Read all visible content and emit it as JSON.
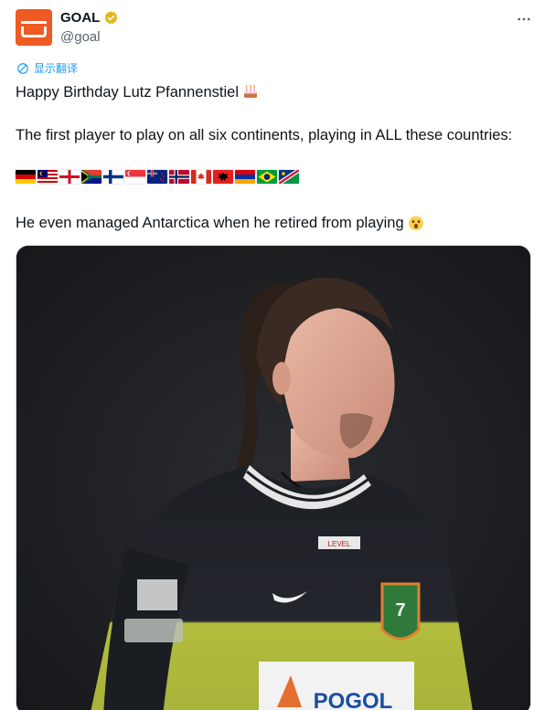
{
  "account": {
    "display_name": "GOAL",
    "handle": "@goal",
    "avatar_icon": "goal-logo-icon",
    "avatar_color": "#f05a23",
    "verified_icon": "verified-badge-icon",
    "verified_color": "#e2b719"
  },
  "menu": {
    "more_icon": "more-horizontal-icon"
  },
  "translate": {
    "label": "显示翻译",
    "icon": "translate-globe-icon",
    "color": "#1d9bf0"
  },
  "tweet": {
    "line1": "Happy Birthday Lutz Pfannenstiel",
    "line1_emoji": "birthday-cake-icon",
    "line2": "The first player to play on all six continents, playing in ALL these countries:",
    "flags": [
      "germany-flag-icon",
      "malaysia-flag-icon",
      "england-flag-icon",
      "south-africa-flag-icon",
      "finland-flag-icon",
      "singapore-flag-icon",
      "new-zealand-flag-icon",
      "norway-flag-icon",
      "canada-flag-icon",
      "albania-flag-icon",
      "armenia-flag-icon",
      "brazil-flag-icon",
      "namibia-flag-icon"
    ],
    "line4": "He even managed Antarctica when he retired from playing",
    "line4_emoji": "shocked-face-icon"
  },
  "media": {
    "kind": "photo",
    "subject": "player-photo",
    "shirt_sponsor": "POGOL",
    "shirt_badge_text": "LEVEL"
  }
}
